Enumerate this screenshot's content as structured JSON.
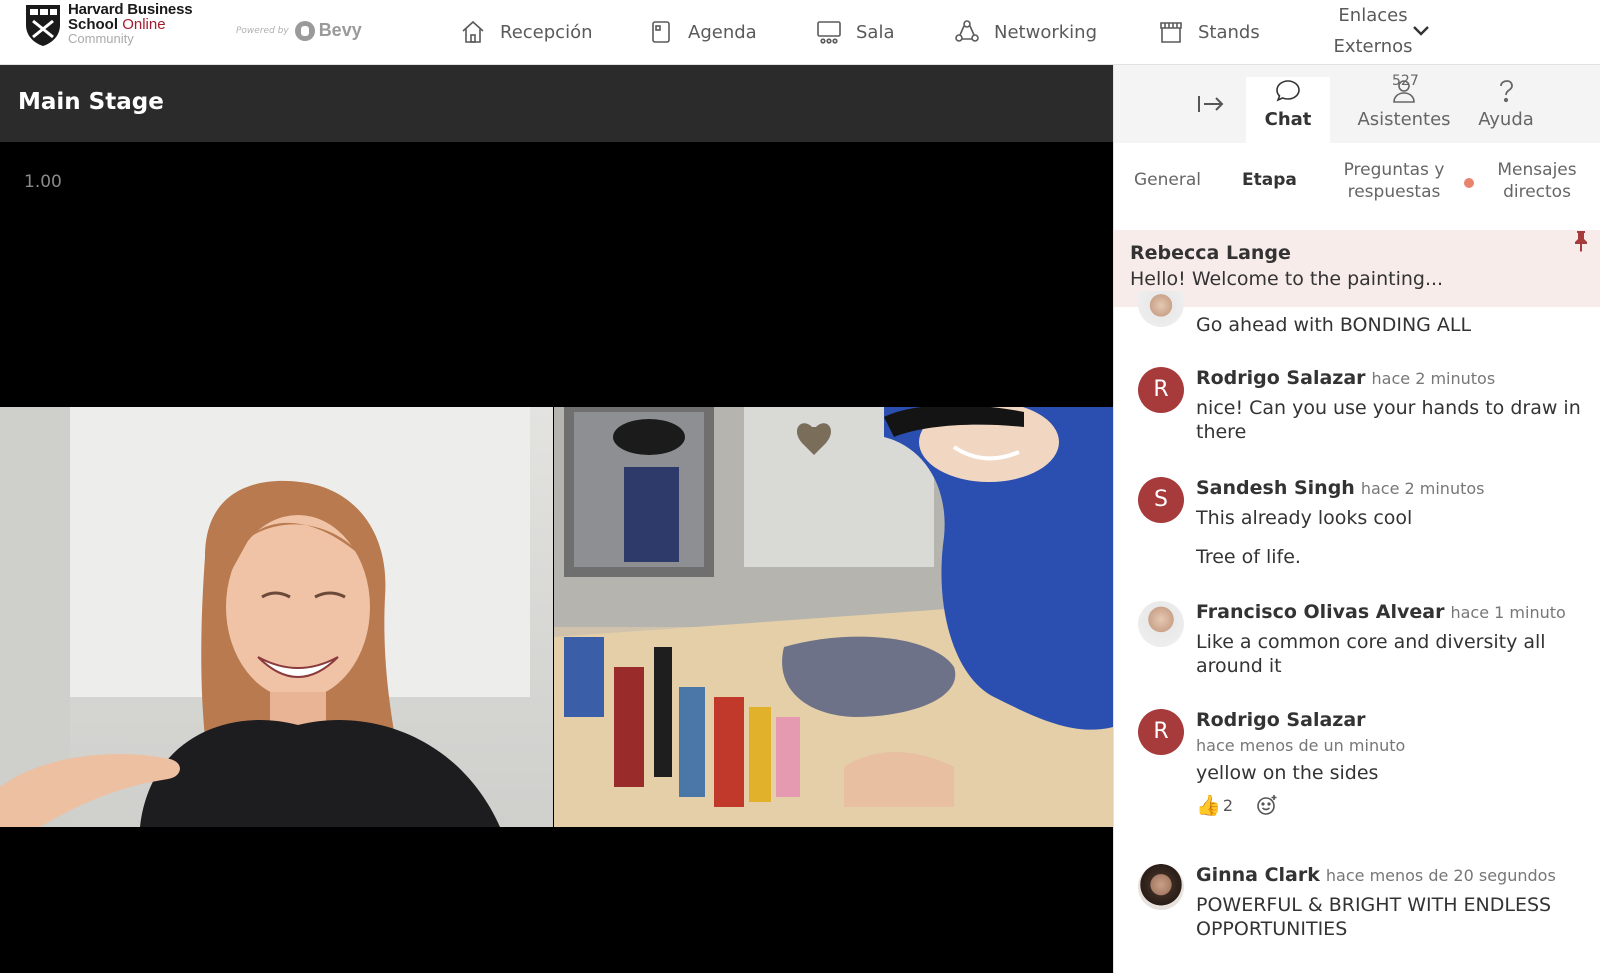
{
  "brand": {
    "line1": "Harvard Business",
    "line2": "School",
    "line2_accent": "Online",
    "line3": "Community",
    "powered_by": "Powered by",
    "bevy": "Bevy"
  },
  "nav": {
    "items": [
      {
        "label": "Recepción",
        "icon": "home-icon"
      },
      {
        "label": "Agenda",
        "icon": "agenda-icon"
      },
      {
        "label": "Sala",
        "icon": "room-icon"
      },
      {
        "label": "Networking",
        "icon": "networking-icon"
      },
      {
        "label": "Stands",
        "icon": "stands-icon"
      }
    ],
    "enlaces_line1": "Enlaces",
    "enlaces_line2": "Externos"
  },
  "stage": {
    "title": "Main Stage",
    "zoom": "1.00"
  },
  "panel": {
    "tabs": {
      "chat": "Chat",
      "asistentes": "Asistentes",
      "asistentes_count": "527",
      "ayuda": "Ayuda"
    },
    "subtabs": {
      "general": "General",
      "etapa": "Etapa",
      "preguntas_l1": "Preguntas y",
      "preguntas_l2": "respuestas",
      "mensajes_l1": "Mensajes",
      "mensajes_l2": "directos"
    },
    "pinned": {
      "name": "Rebecca Lange",
      "text": "Hello! Welcome to the painting..."
    },
    "messages": [
      {
        "text": "Go ahead with BONDING ALL"
      },
      {
        "initial": "R",
        "name": "Rodrigo Salazar",
        "time": "hace 2 minutos",
        "text": "nice! Can you use your hands to draw in there"
      },
      {
        "initial": "S",
        "name": "Sandesh Singh",
        "time": "hace 2 minutos",
        "text": "This already looks cool",
        "text2": "Tree of life."
      },
      {
        "name": "Francisco Olivas Alvear",
        "time": "hace 1 minuto",
        "text": "Like a common core and diversity all around it"
      },
      {
        "initial": "R",
        "name": "Rodrigo Salazar",
        "time": "hace menos de un minuto",
        "text": "yellow on the sides",
        "reaction_count": "2"
      },
      {
        "name": "Ginna Clark",
        "time": "hace menos de 20 segundos",
        "text": "POWERFUL & BRIGHT WITH ENDLESS OPPORTUNITIES"
      }
    ]
  }
}
